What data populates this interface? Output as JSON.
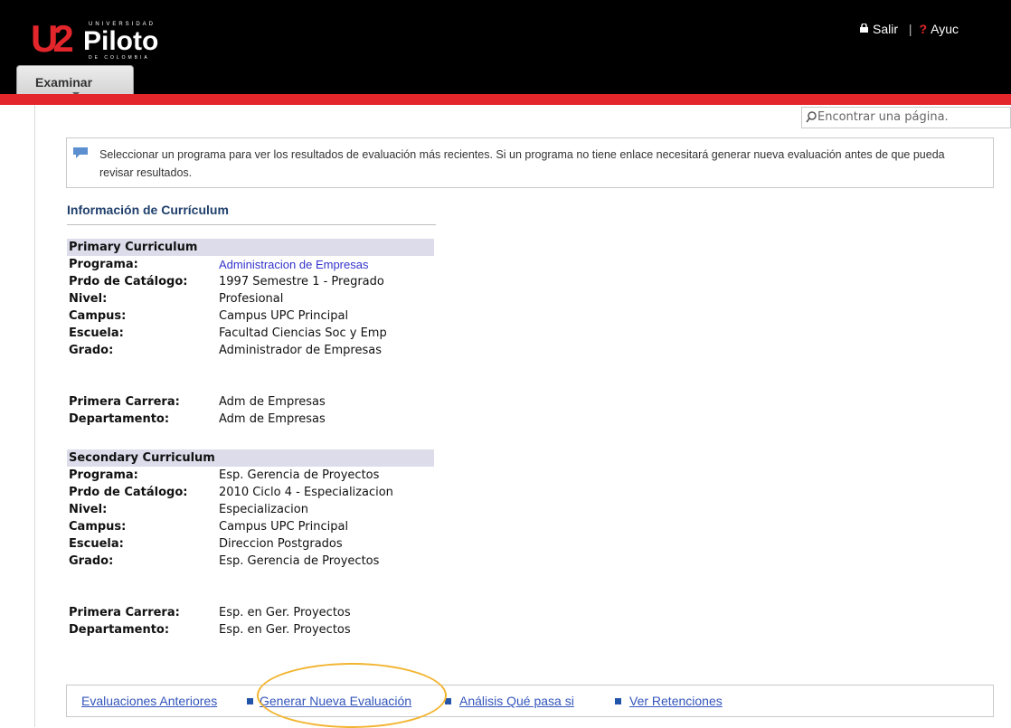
{
  "header": {
    "logo": {
      "top_text": "UNIVERSIDAD",
      "mark": "U2",
      "word": "Piloto",
      "bottom_text": "DE COLOMBIA"
    },
    "exit_label": "Salir",
    "help_label": "Ayuc",
    "examinar_label": "Examinar",
    "search_placeholder": "Encontrar una página."
  },
  "notice": {
    "text": "Seleccionar un programa para ver los resultados de evaluación más recientes. Si un programa no tiene enlace necesitará generar nueva evaluación antes de que pueda revisar resultados."
  },
  "section_title": "Información de Currículum",
  "primary": {
    "header": "Primary Curriculum",
    "rows": [
      {
        "label": "Programa:",
        "value": "Administracion de Empresas",
        "link": true
      },
      {
        "label": "Prdo de Catálogo:",
        "value": "1997 Semestre 1 - Pregrado"
      },
      {
        "label": "Nivel:",
        "value": "Profesional"
      },
      {
        "label": "Campus:",
        "value": "Campus UPC Principal"
      },
      {
        "label": "Escuela:",
        "value": "Facultad Ciencias Soc y Emp"
      },
      {
        "label": "Grado:",
        "value": "Administrador de Empresas"
      }
    ],
    "career_rows": [
      {
        "label": "Primera Carrera:",
        "value": "Adm de Empresas"
      },
      {
        "label": "Departamento:",
        "value": "Adm de Empresas"
      }
    ]
  },
  "secondary": {
    "header": "Secondary Curriculum",
    "rows": [
      {
        "label": "Programa:",
        "value": "Esp. Gerencia de Proyectos"
      },
      {
        "label": "Prdo de Catálogo:",
        "value": "2010 Ciclo 4 - Especializacion"
      },
      {
        "label": "Nivel:",
        "value": "Especializacion"
      },
      {
        "label": "Campus:",
        "value": "Campus UPC Principal"
      },
      {
        "label": "Escuela:",
        "value": "Direccion Postgrados"
      },
      {
        "label": "Grado:",
        "value": "Esp. Gerencia de Proyectos"
      }
    ],
    "career_rows": [
      {
        "label": "Primera Carrera:",
        "value": "Esp. en Ger. Proyectos"
      },
      {
        "label": "Departamento:",
        "value": "Esp. en Ger. Proyectos"
      }
    ]
  },
  "bottom_links": [
    "Evaluaciones Anteriores",
    "Generar Nueva Evaluación",
    "Análisis Qué pasa si",
    "Ver Retenciones"
  ],
  "colors": {
    "brand_red": "#e3262b",
    "link_blue": "#3355bb",
    "highlight": "#f2b430"
  }
}
